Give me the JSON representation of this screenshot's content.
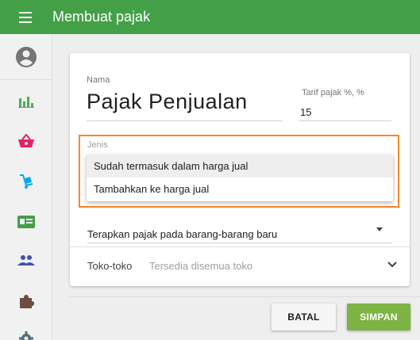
{
  "appbar": {
    "title": "Membuat pajak",
    "bg": "#43a047"
  },
  "sidebar": {
    "items": [
      {
        "icon": "account-icon"
      },
      {
        "icon": "bar-chart-icon",
        "color": "#4caf50"
      },
      {
        "icon": "basket-icon",
        "color": "#e91e63"
      },
      {
        "icon": "dolly-icon",
        "color": "#03a9f4"
      },
      {
        "icon": "id-card-icon",
        "color": "#43a047"
      },
      {
        "icon": "people-icon",
        "color": "#3f51b5"
      },
      {
        "icon": "puzzle-icon",
        "color": "#6d4c41"
      },
      {
        "icon": "gear-icon",
        "color": "#546e7a"
      }
    ]
  },
  "form": {
    "name_label": "Nama",
    "name_value": "Pajak Penjualan",
    "rate_label": "Tarif pajak %, %",
    "rate_value": "15",
    "type_label": "Jenis",
    "type_options": [
      "Sudah termasuk dalam harga jual",
      "Tambahkan ke harga jual"
    ],
    "apply_value": "Terapkan pajak pada barang-barang baru",
    "stores_label": "Toko-toko",
    "stores_value": "Tersedia disemua toko"
  },
  "actions": {
    "cancel": "BATAL",
    "save": "SIMPAN"
  },
  "colors": {
    "highlight": "#f5872a",
    "save": "#7cb342"
  }
}
